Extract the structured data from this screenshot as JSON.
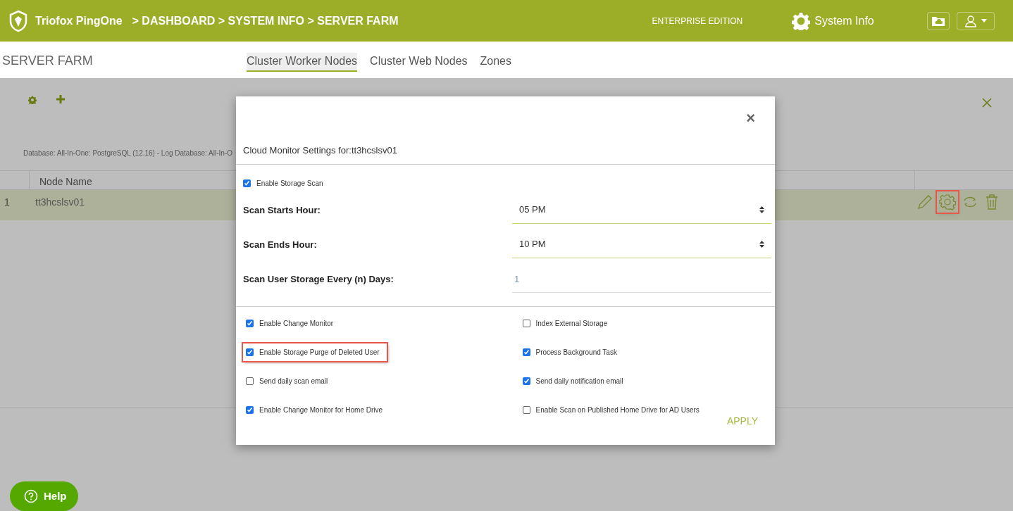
{
  "header": {
    "brand": "Triofox PingOne",
    "breadcrumb": "> DASHBOARD > SYSTEM INFO > SERVER FARM",
    "edition": "ENTERPRISE EDITION",
    "section": "System Info"
  },
  "page_title": "SERVER FARM",
  "tabs": [
    {
      "label": "Cluster Worker Nodes",
      "selected": true
    },
    {
      "label": "Cluster Web Nodes",
      "selected": false
    },
    {
      "label": "Zones",
      "selected": false
    }
  ],
  "info_text": "Database: All-In-One: PostgreSQL (12.16) - Log Database: All-In-O",
  "table": {
    "columns": [
      "Node Name"
    ],
    "rows": [
      {
        "index": "1",
        "name": "tt3hcslsv01",
        "selected": true,
        "actions": [
          {
            "kind": "edit",
            "highlighted": false
          },
          {
            "kind": "settings",
            "highlighted": true
          },
          {
            "kind": "sync",
            "highlighted": false
          },
          {
            "kind": "delete",
            "highlighted": false
          }
        ]
      }
    ]
  },
  "modal": {
    "close": "×",
    "title": "Cloud Monitor Settings for:tt3hcslsv01",
    "scan": {
      "label": "Enable Storage Scan",
      "checked": true
    },
    "fields": [
      {
        "label": "Scan Starts Hour:",
        "kind": "select",
        "value": "05 PM"
      },
      {
        "label": "Scan Ends Hour:",
        "kind": "select",
        "value": "10 PM"
      },
      {
        "label": "Scan User Storage Every (n) Days:",
        "kind": "input",
        "value": "1"
      }
    ],
    "options": [
      {
        "label": "Enable Change Monitor",
        "checked": true,
        "highlighted": false
      },
      {
        "label": "Index External Storage",
        "checked": false,
        "highlighted": false
      },
      {
        "label": "Enable Storage Purge of Deleted User",
        "checked": true,
        "highlighted": true
      },
      {
        "label": "Process Background Task",
        "checked": true,
        "highlighted": false
      },
      {
        "label": "Send daily scan email",
        "checked": false,
        "highlighted": false
      },
      {
        "label": "Send daily notification email",
        "checked": true,
        "highlighted": false
      },
      {
        "label": "Enable Change Monitor for Home Drive",
        "checked": true,
        "highlighted": false
      },
      {
        "label": "Enable Scan on Published Home Drive for AD Users",
        "checked": false,
        "highlighted": false
      }
    ],
    "apply": "APPLY"
  },
  "help": "Help"
}
